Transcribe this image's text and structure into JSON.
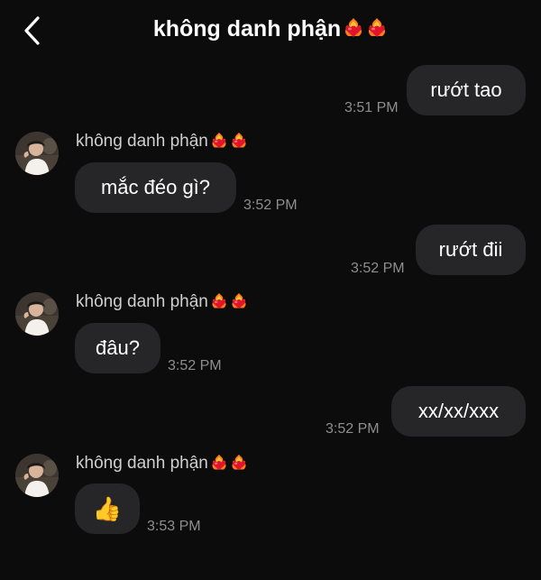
{
  "header": {
    "title": "không danh phận",
    "title_emojis": [
      "heart-on-fire-icon",
      "heart-on-fire-icon"
    ]
  },
  "colors": {
    "background": "#0c0c0c",
    "bubble": "#262628",
    "text": "#ffffff",
    "timestamp": "#8e8e8e",
    "sender_name": "#cfcfcf"
  },
  "messages": [
    {
      "direction": "outgoing",
      "text": "rướt tao",
      "time": "3:51 PM"
    },
    {
      "direction": "incoming",
      "sender": "không danh phận",
      "text": "mắc đéo gì?",
      "time": "3:52 PM"
    },
    {
      "direction": "outgoing",
      "text": "rướt đii",
      "time": "3:52 PM"
    },
    {
      "direction": "incoming",
      "sender": "không danh phận",
      "text": "đâu?",
      "time": "3:52 PM"
    },
    {
      "direction": "outgoing",
      "text": "xx/xx/xxx",
      "time": "3:52 PM"
    },
    {
      "direction": "incoming",
      "sender": "không danh phận",
      "text": "👍",
      "time": "3:53 PM"
    }
  ]
}
